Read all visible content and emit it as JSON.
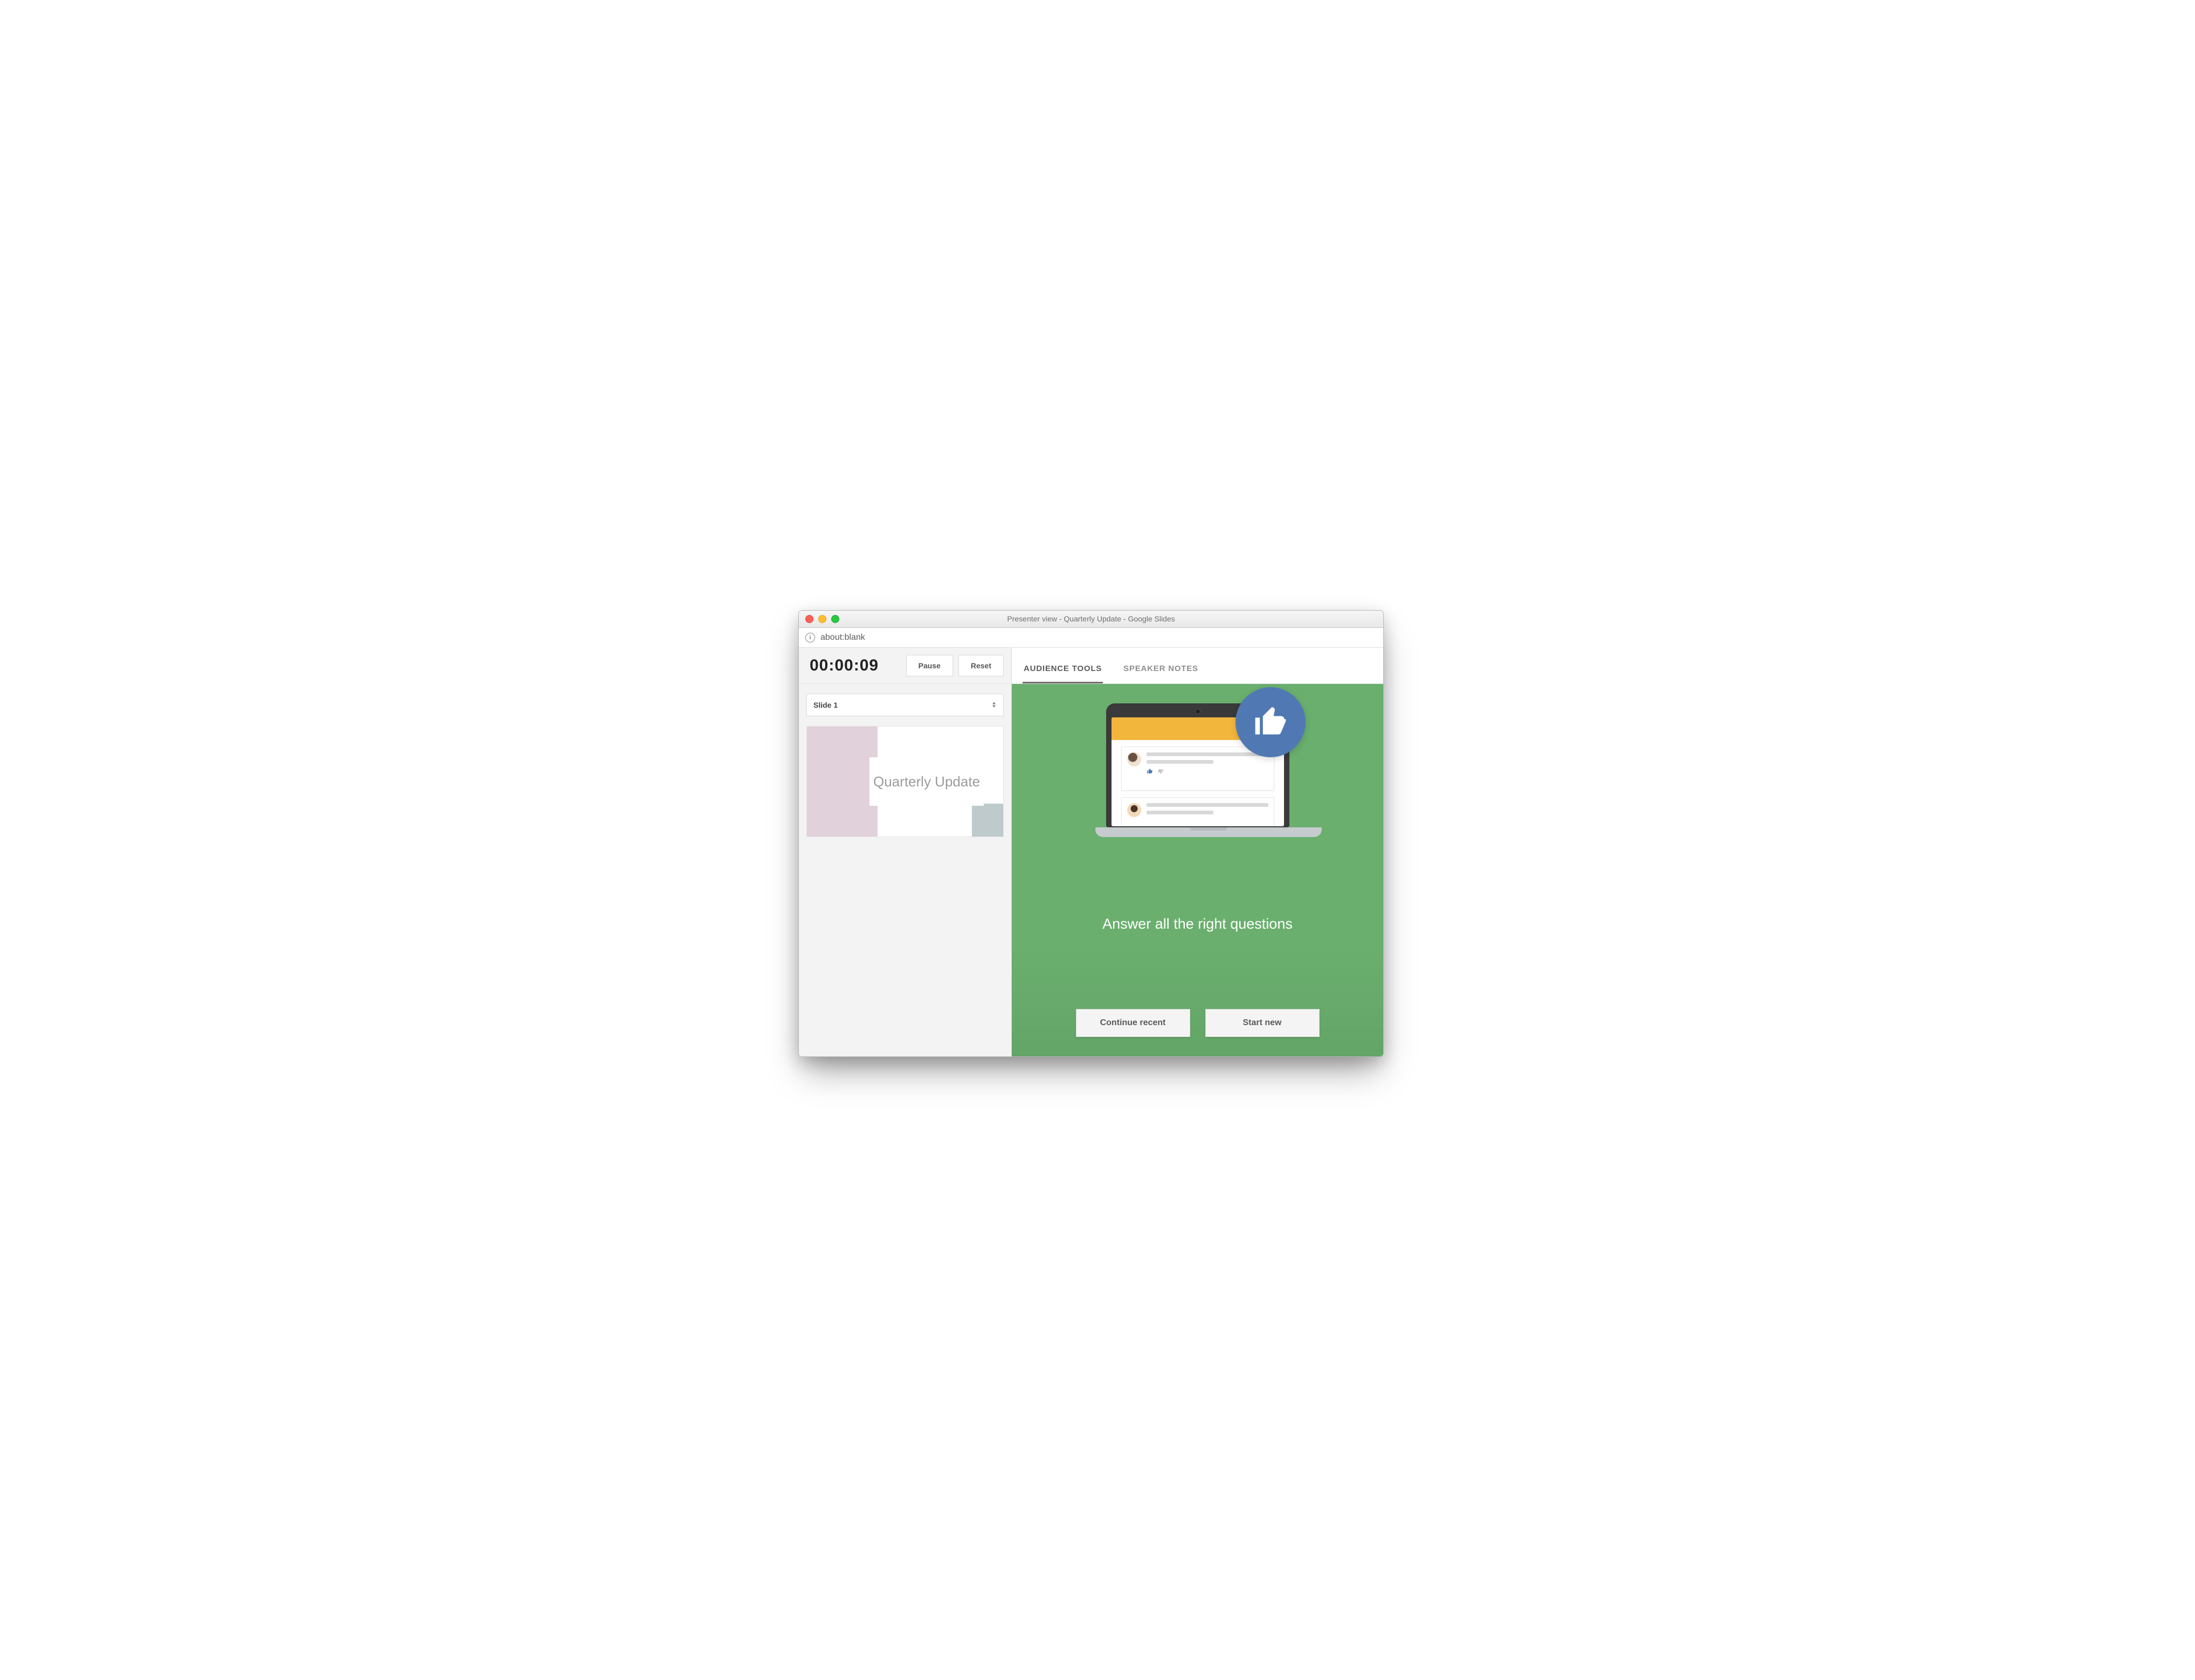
{
  "window": {
    "title": "Presenter view - Quarterly Update - Google Slides",
    "address": "about:blank"
  },
  "timer": {
    "value": "00:00:09",
    "pause_label": "Pause",
    "reset_label": "Reset"
  },
  "slide_selector": {
    "selected": "Slide 1"
  },
  "thumbnail": {
    "title_text": "Quarterly Update"
  },
  "tabs": {
    "audience_tools": "AUDIENCE TOOLS",
    "speaker_notes": "SPEAKER NOTES",
    "active": "audience_tools"
  },
  "panel": {
    "headline": "Answer all the right questions",
    "continue_label": "Continue recent",
    "start_label": "Start new"
  },
  "colors": {
    "panel_bg": "#6aaf6e",
    "badge_bg": "#5079b3",
    "screen_header": "#f2b63c"
  }
}
